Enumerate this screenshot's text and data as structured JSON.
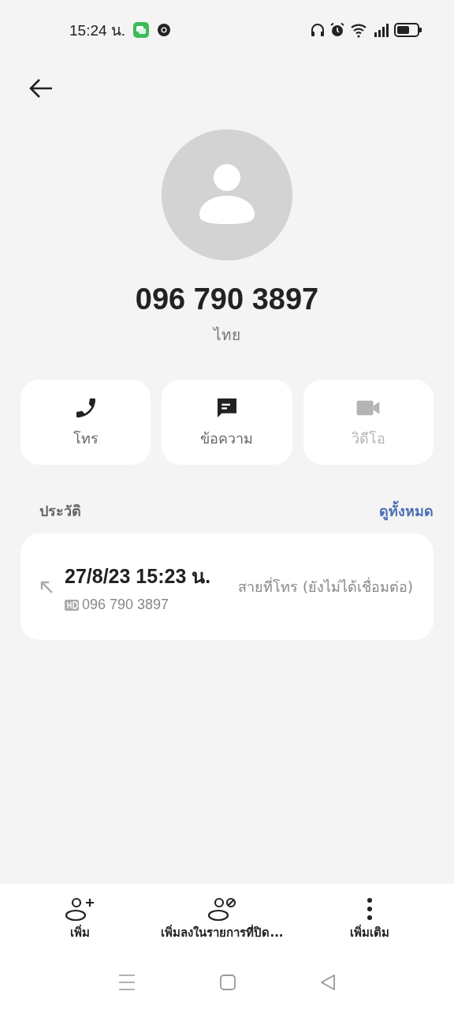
{
  "status_bar": {
    "time": "15:24 น.",
    "notification_icons": [
      {
        "kind": "chat"
      },
      {
        "kind": "browser"
      }
    ]
  },
  "contact": {
    "number": "096 790 3897",
    "location": "ไทย"
  },
  "actions": [
    {
      "kind": "call",
      "label": "โทร",
      "disabled": false
    },
    {
      "kind": "message",
      "label": "ข้อความ",
      "disabled": false
    },
    {
      "kind": "video",
      "label": "วิดีโอ",
      "disabled": true
    }
  ],
  "history": {
    "title": "ประวัติ",
    "link": "ดูทั้งหมด",
    "entries": [
      {
        "datetime": "27/8/23 15:23 น.",
        "number": "096 790 3897",
        "status": "สายที่โทร (ยังไม่ได้เชื่อมต่อ)"
      }
    ]
  },
  "bottom_actions": [
    {
      "kind": "add",
      "label": "เพิ่ม"
    },
    {
      "kind": "block",
      "label": "เพิ่มลงในรายการที่ปิด..."
    },
    {
      "kind": "more",
      "label": "เพิ่มเติม"
    }
  ]
}
